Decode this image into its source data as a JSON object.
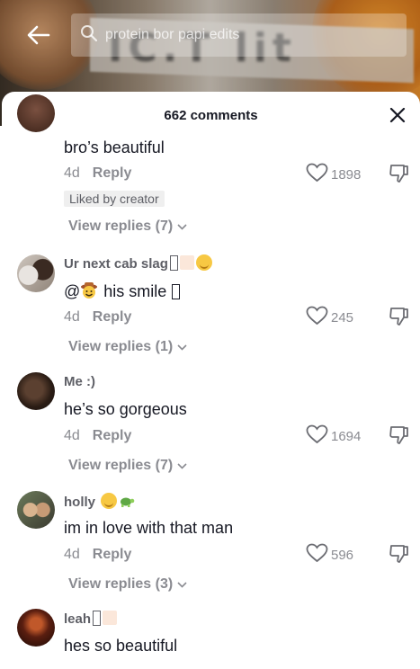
{
  "search": {
    "placeholder": "protein bor papi edits"
  },
  "sheet": {
    "comment_count_label": "662 comments"
  },
  "comments": [
    {
      "username": "",
      "text": "bro’s beautiful",
      "age": "4d",
      "reply_label": "Reply",
      "badge": "Liked by creator",
      "likes": "1898",
      "view_replies": "View replies (7)"
    },
    {
      "username": "Ur next cab slag",
      "text_mention": "@",
      "text": "his smile",
      "age": "4d",
      "reply_label": "Reply",
      "likes": "245",
      "view_replies": "View replies (1)"
    },
    {
      "username": "Me :)",
      "text": "he’s so gorgeous",
      "age": "4d",
      "reply_label": "Reply",
      "likes": "1694",
      "view_replies": "View replies (7)"
    },
    {
      "username": "holly",
      "text": "im in love with that man",
      "age": "4d",
      "reply_label": "Reply",
      "likes": "596",
      "view_replies": "View replies (3)"
    },
    {
      "username": "leah",
      "text": "hes so beautiful"
    }
  ],
  "colors": {
    "primary_text": "#161823",
    "secondary_text": "#8a8b91",
    "username_text": "#5e5f66",
    "badge_bg": "#efefef"
  }
}
